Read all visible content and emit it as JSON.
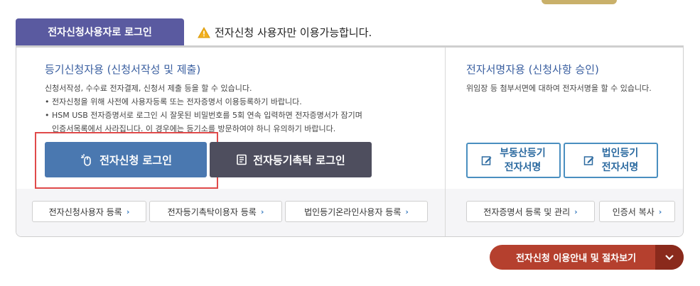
{
  "tab": {
    "label": "전자신청사용자로 로그인"
  },
  "notice": {
    "text": "전자신청 사용자만 이용가능합니다."
  },
  "left": {
    "title": "등기신청자용 (신청서작성 및 제출)",
    "lines": [
      "신청서작성, 수수료 전자결제, 신청서 제출 등을 할 수 있습니다.",
      "• 전자신청을 위해 사전에 사용자등록 또는 전자증명서 이용등록하기 바랍니다.",
      "• HSM USB 전자증명서로 로그인 시 잘못된 비밀번호를 5회 연속 입력하면 전자증명서가 잠기며",
      "  인증서목록에서 사라집니다. 이 경우에는 등기소를 방문하여야 하니 유의하기 바랍니다."
    ],
    "login_button": "전자신청 로그인",
    "agent_button": "전자등기촉탁 로그인",
    "links": [
      "전자신청사용자 등록",
      "전자등기촉탁이용자 등록",
      "법인등기온라인사용자 등록"
    ]
  },
  "right": {
    "title": "전자서명자용 (신청사항 승인)",
    "desc": "위임장 등 첨부서면에 대하여 전자서명을 할 수 있습니다.",
    "sign_buttons": [
      {
        "line1": "부동산등기",
        "line2": "전자서명"
      },
      {
        "line1": "법인등기",
        "line2": "전자서명"
      }
    ],
    "links": [
      "전자증명서 등록 및 관리",
      "인증서 복사"
    ]
  },
  "guide": {
    "label": "전자신청 이용안내 및 절차보기"
  },
  "colors": {
    "tab": "#5a5aa0",
    "login": "#4a78b0",
    "agent": "#4e4e5e",
    "guide": "#b5402e",
    "highlight": "#e04a4a"
  }
}
